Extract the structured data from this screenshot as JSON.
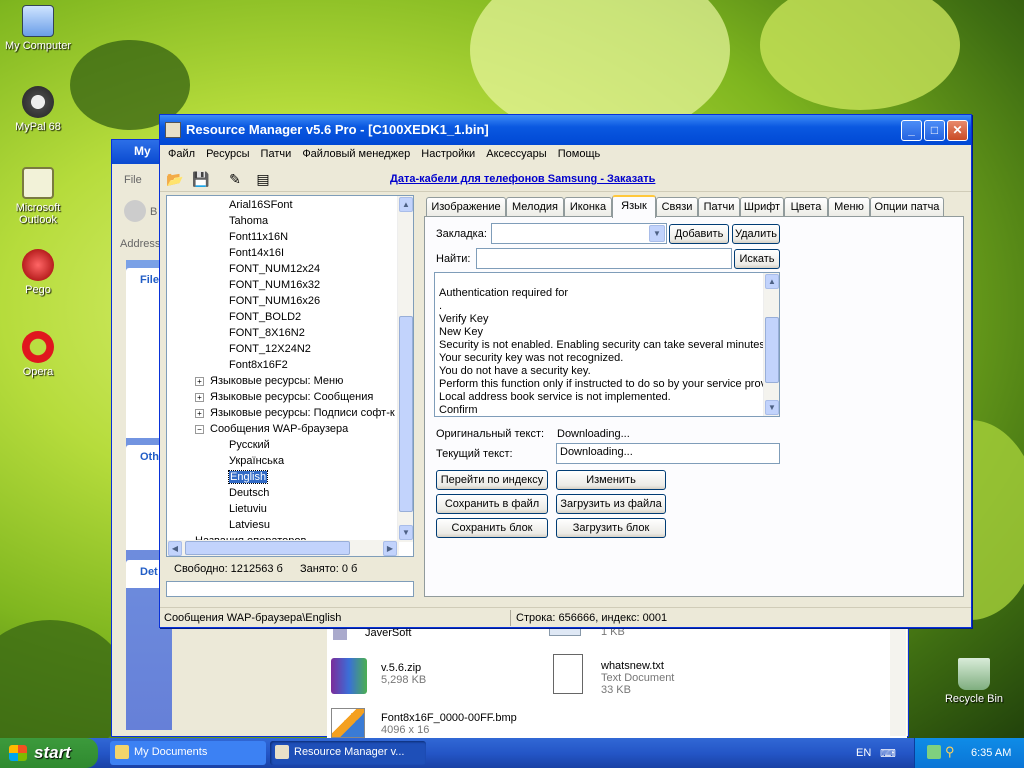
{
  "desktop": {
    "icons": [
      {
        "label": "My Computer"
      },
      {
        "label": "MyPal 68"
      },
      {
        "label": "Microsoft Outlook"
      },
      {
        "label": "Pego"
      },
      {
        "label": "Opera"
      },
      {
        "label": "Recycle Bin"
      }
    ]
  },
  "bg_window": {
    "title": "My",
    "menu_file": "File",
    "back_label": "B",
    "address_label": "Address",
    "panel1": "File",
    "panel2": "Oth",
    "panel3": "Det",
    "files": [
      {
        "name": "JaverSoft",
        "sub": ""
      },
      {
        "name": "",
        "sub": "1 KB"
      },
      {
        "name": "v.5.6.zip",
        "sub": "5,298 KB"
      },
      {
        "name": "whatsnew.txt",
        "sub": "Text Document"
      },
      {
        "name": "",
        "sub": "33 KB"
      },
      {
        "name": "Font8x16F_0000-00FF.bmp",
        "sub": "4096 x 16"
      }
    ]
  },
  "window": {
    "title": "Resource Manager v5.6 Pro - [C100XEDK1_1.bin]",
    "menu": [
      "Файл",
      "Ресурсы",
      "Патчи",
      "Файловый менеджер",
      "Настройки",
      "Аксессуары",
      "Помощь"
    ],
    "promo_link": "Дата-кабели для телефонов Samsung - Заказать",
    "tree": [
      {
        "label": "Arial16SFont",
        "level": 2
      },
      {
        "label": "Tahoma",
        "level": 2
      },
      {
        "label": "Font11x16N",
        "level": 2
      },
      {
        "label": "Font14x16I",
        "level": 2
      },
      {
        "label": "FONT_NUM12x24",
        "level": 2
      },
      {
        "label": "FONT_NUM16x32",
        "level": 2
      },
      {
        "label": "FONT_NUM16x26",
        "level": 2
      },
      {
        "label": "FONT_BOLD2",
        "level": 2
      },
      {
        "label": "FONT_8X16N2",
        "level": 2
      },
      {
        "label": "FONT_12X24N2",
        "level": 2
      },
      {
        "label": "Font8x16F2",
        "level": 2
      },
      {
        "label": "Языковые ресурсы: Меню",
        "level": 1,
        "exp": "+"
      },
      {
        "label": "Языковые ресурсы: Сообщения",
        "level": 1,
        "exp": "+"
      },
      {
        "label": "Языковые ресурсы: Подписи софт-к",
        "level": 1,
        "exp": "+"
      },
      {
        "label": "Сообщения WAP-браузера",
        "level": 1,
        "exp": "−"
      },
      {
        "label": "Русский",
        "level": 2
      },
      {
        "label": "Українська",
        "level": 2
      },
      {
        "label": "English",
        "level": 2,
        "selected": true
      },
      {
        "label": "Deutsch",
        "level": 2
      },
      {
        "label": "Lietuviu",
        "level": 2
      },
      {
        "label": "Latviesu",
        "level": 2
      },
      {
        "label": "Названия операторов",
        "level": 1
      }
    ],
    "free_label": "Свободно: 1212563 б",
    "used_label": "Занято: 0 б",
    "tabs": [
      "Изображение",
      "Мелодия",
      "Иконка",
      "Язык",
      "Связи",
      "Патчи",
      "Шрифт",
      "Цвета",
      "Меню",
      "Опции патча"
    ],
    "active_tab": 3,
    "bookmark_label": "Закладка:",
    "bookmark_value": "",
    "add_button": "Добавить",
    "delete_button": "Удалить",
    "find_label": "Найти:",
    "find_value": "",
    "search_button": "Искать",
    "messages": [
      "Authentication required for",
      ".",
      "Verify Key",
      "New Key",
      "Security is not enabled. Enabling security can take several minutes. I",
      "Your security key was not recognized.",
      "You do not have a security key.",
      "Perform this function only if instructed to do so by your service provid",
      "Local address book service is not implemented.",
      "Confirm"
    ],
    "original_label": "Оригинальный текст:",
    "original_value": "Downloading...",
    "current_label": "Текущий текст:",
    "current_value": "Downloading...",
    "goto_index_button": "Перейти по индексу",
    "change_button": "Изменить",
    "save_file_button": "Сохранить в файл",
    "load_file_button": "Загрузить из файла",
    "save_block_button": "Сохранить блок",
    "load_block_button": "Загрузить блок",
    "status_path": "Сообщения WAP-браузера\\English",
    "status_pos": "Строка: 656666, индекс: 0001"
  },
  "taskbar": {
    "start_label": "start",
    "tasks": [
      "My Documents",
      "Resource Manager v..."
    ],
    "lang": "EN",
    "clock": "6:35 AM"
  }
}
